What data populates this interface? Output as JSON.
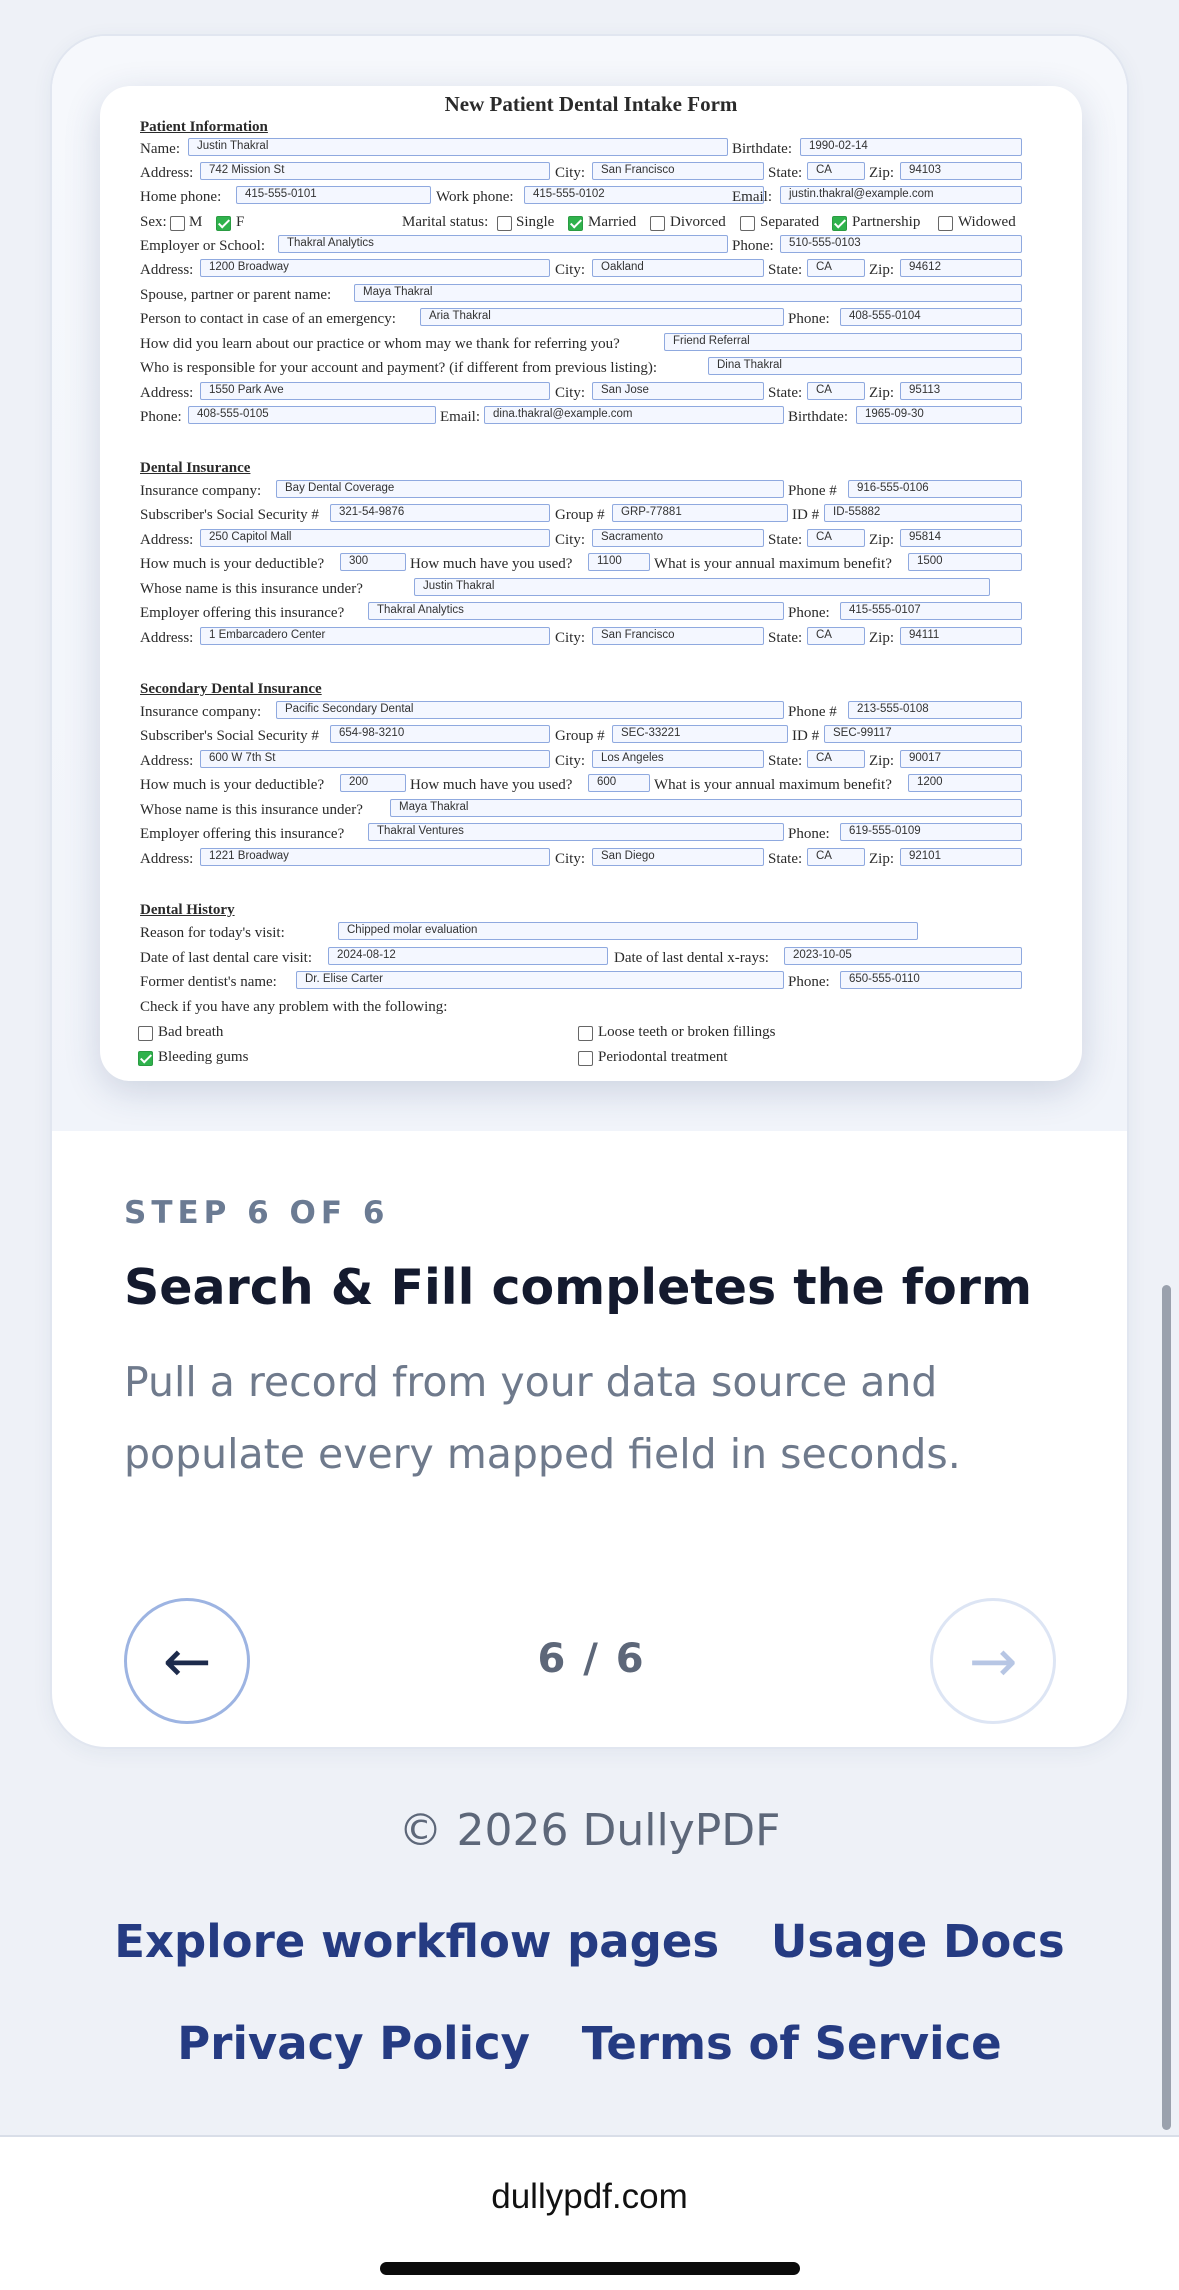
{
  "form": {
    "title": "New Patient Dental Intake Form",
    "sections": {
      "patient": "Patient Information",
      "insurance": "Dental Insurance",
      "secondary": "Secondary Dental Insurance",
      "history": "Dental History"
    },
    "labels": {
      "name": "Name:",
      "birthdate": "Birthdate:",
      "address": "Address:",
      "city": "City:",
      "state": "State:",
      "zip": "Zip:",
      "home_phone": "Home phone:",
      "work_phone": "Work phone:",
      "email": "Email:",
      "sex": "Sex:",
      "m": "M",
      "f": "F",
      "marital": "Marital status:",
      "single": "Single",
      "married": "Married",
      "divorced": "Divorced",
      "separated": "Separated",
      "partnership": "Partnership",
      "widowed": "Widowed",
      "employer": "Employer or School:",
      "phone": "Phone:",
      "spouse": "Spouse, partner or parent name:",
      "emergency": "Person to contact in case of an emergency:",
      "referral": "How did you learn about our practice or whom may we thank for referring you?",
      "responsible": "Who is responsible for your account and payment? (if different from previous listing):",
      "ins_company": "Insurance company:",
      "phone_hash": "Phone #",
      "ssn": "Subscriber's Social Security #",
      "group": "Group #",
      "id": "ID #",
      "deductible": "How much is your deductible?",
      "used": "How much have you used?",
      "max_benefit": "What is your annual maximum benefit?",
      "whose": "Whose name is this insurance under?",
      "employer_ins": "Employer offering this insurance?",
      "reason": "Reason for today's visit:",
      "last_care": "Date of last dental care visit:",
      "last_xray": "Date of last dental x-rays:",
      "former_dentist": "Former dentist's name:",
      "check_problems": "Check if you have any problem with the following:",
      "bad_breath": "Bad breath",
      "loose_teeth": "Loose teeth or broken fillings",
      "bleeding_gums": "Bleeding gums",
      "periodontal": "Periodontal treatment"
    },
    "values": {
      "name": "Justin Thakral",
      "birthdate": "1990-02-14",
      "address": "742 Mission St",
      "city": "San Francisco",
      "state": "CA",
      "zip": "94103",
      "home_phone": "415-555-0101",
      "work_phone": "415-555-0102",
      "email": "justin.thakral@example.com",
      "employer": "Thakral Analytics",
      "employer_phone": "510-555-0103",
      "employer_address": "1200 Broadway",
      "employer_city": "Oakland",
      "employer_state": "CA",
      "employer_zip": "94612",
      "spouse": "Maya Thakral",
      "emergency": "Aria Thakral",
      "emergency_phone": "408-555-0104",
      "referral": "Friend Referral",
      "responsible": "Dina Thakral",
      "resp_address": "1550 Park Ave",
      "resp_city": "San Jose",
      "resp_state": "CA",
      "resp_zip": "95113",
      "resp_phone": "408-555-0105",
      "resp_email": "dina.thakral@example.com",
      "resp_birthdate": "1965-09-30",
      "ins_company": "Bay Dental Coverage",
      "ins_phone": "916-555-0106",
      "ins_ssn": "321-54-9876",
      "ins_group": "GRP-77881",
      "ins_id": "ID-55882",
      "ins_address": "250 Capitol Mall",
      "ins_city": "Sacramento",
      "ins_state": "CA",
      "ins_zip": "95814",
      "ins_deductible": "300",
      "ins_used": "1100",
      "ins_max": "1500",
      "ins_whose": "Justin Thakral",
      "ins_employer": "Thakral Analytics",
      "ins_emp_phone": "415-555-0107",
      "ins_emp_address": "1 Embarcadero Center",
      "ins_emp_city": "San Francisco",
      "ins_emp_state": "CA",
      "ins_emp_zip": "94111",
      "sec_company": "Pacific Secondary Dental",
      "sec_phone": "213-555-0108",
      "sec_ssn": "654-98-3210",
      "sec_group": "SEC-33221",
      "sec_id": "SEC-99117",
      "sec_address": "600 W 7th St",
      "sec_city": "Los Angeles",
      "sec_state": "CA",
      "sec_zip": "90017",
      "sec_deductible": "200",
      "sec_used": "600",
      "sec_max": "1200",
      "sec_whose": "Maya Thakral",
      "sec_employer": "Thakral Ventures",
      "sec_emp_phone": "619-555-0109",
      "sec_emp_address": "1221 Broadway",
      "sec_emp_city": "San Diego",
      "sec_emp_state": "CA",
      "sec_emp_zip": "92101",
      "reason": "Chipped molar evaluation",
      "last_care": "2024-08-12",
      "last_xray": "2023-10-05",
      "former_dentist": "Dr. Elise Carter",
      "dentist_phone": "650-555-0110"
    },
    "checks": {
      "m": false,
      "f": true,
      "single": false,
      "married": true,
      "divorced": false,
      "separated": false,
      "partnership": true,
      "widowed": false,
      "bad_breath": false,
      "loose_teeth": false,
      "bleeding_gums": true,
      "periodontal": false
    }
  },
  "step": {
    "label": "STEP 6 OF 6",
    "title": "Search & Fill completes the form",
    "description": "Pull a record from your data source and populate every mapped field in seconds."
  },
  "carousel": {
    "counter": "6 / 6",
    "prev_icon": "arrow-left-icon",
    "next_icon": "arrow-right-icon",
    "prev_glyph": "←",
    "next_glyph": "→"
  },
  "footer": {
    "copyright": "© 2026 DullyPDF",
    "links": [
      "Explore workflow pages",
      "Usage Docs",
      "Privacy Policy",
      "Terms of Service"
    ]
  },
  "browser": {
    "url": "dullypdf.com"
  }
}
